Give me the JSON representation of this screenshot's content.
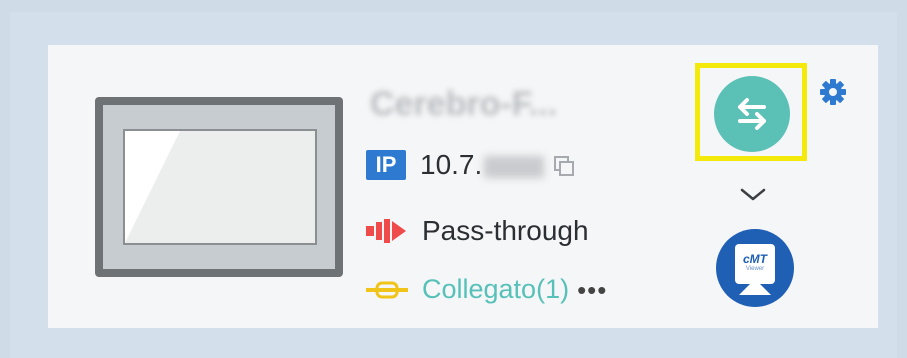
{
  "device": {
    "name": "Cerebro-F...",
    "ip_badge": "IP",
    "ip_prefix": "10.7.",
    "mode_label": "Pass-through",
    "status_label": "Collegato(1)",
    "more_label": "•••"
  },
  "actions": {
    "cmt_label": "cMT",
    "cmt_sublabel": "Viewer"
  },
  "colors": {
    "accent_teal": "#5bc0b6",
    "ip_blue": "#2e7ad1",
    "mode_red": "#ef4b4b",
    "link_yellow": "#f0c419",
    "gear_blue": "#2e7ad1",
    "highlight": "#f3ea0b",
    "cmt_blue": "#1f5fb4"
  },
  "icons": {
    "swap": "swap-arrows-icon",
    "settings": "gear-icon",
    "expand": "chevron-down-icon",
    "cmt": "cmt-viewer-icon",
    "copy": "copy-icon",
    "mode": "pass-through-icon",
    "link": "link-icon"
  }
}
